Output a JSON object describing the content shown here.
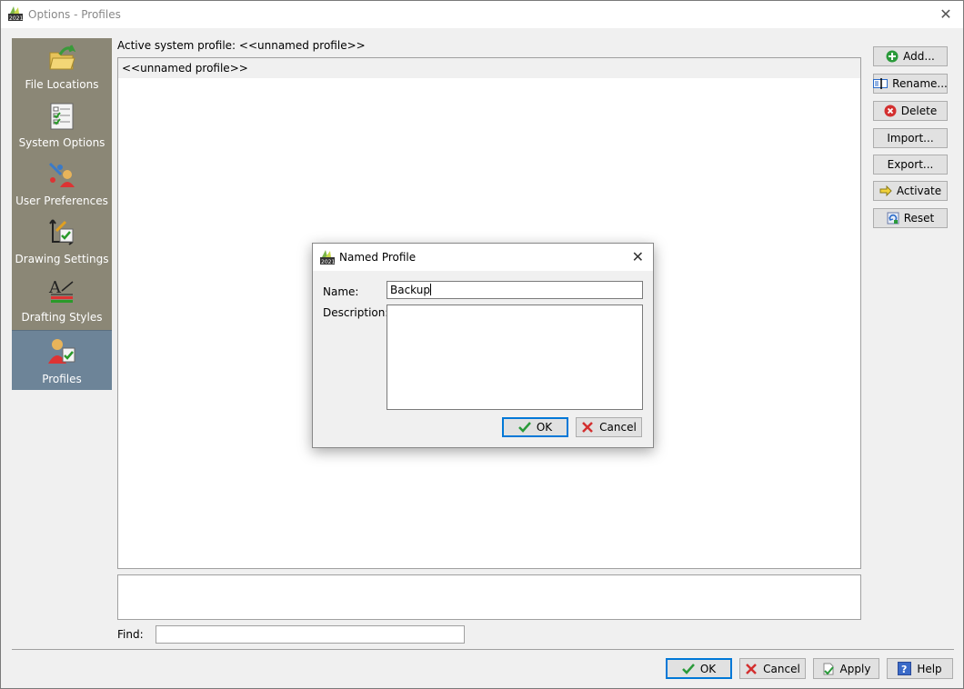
{
  "window": {
    "title": "Options - Profiles",
    "close_glyph": "✕"
  },
  "sidebar": {
    "items": [
      {
        "label": "File Locations",
        "icon": "folder-arrow-icon"
      },
      {
        "label": "System Options",
        "icon": "checklist-icon"
      },
      {
        "label": "User Preferences",
        "icon": "user-preferences-icon"
      },
      {
        "label": "Drawing Settings",
        "icon": "drawing-settings-icon"
      },
      {
        "label": "Drafting Styles",
        "icon": "drafting-styles-icon"
      },
      {
        "label": "Profiles",
        "icon": "profiles-icon",
        "active": true
      }
    ]
  },
  "main": {
    "active_profile_label": "Active system profile:  <<unnamed profile>>",
    "profiles": [
      "<<unnamed profile>>"
    ],
    "find_label": "Find:"
  },
  "right_buttons": {
    "add": "Add...",
    "rename": "Rename...",
    "delete": "Delete",
    "import": "Import...",
    "export": "Export...",
    "activate": "Activate",
    "reset": "Reset"
  },
  "bottom_buttons": {
    "ok": "OK",
    "cancel": "Cancel",
    "apply": "Apply",
    "help": "Help"
  },
  "dialog": {
    "title": "Named Profile",
    "name_label": "Name:",
    "name_value": "Backup",
    "description_label": "Description:",
    "ok": "OK",
    "cancel": "Cancel",
    "close_glyph": "✕"
  },
  "colors": {
    "sidebar_bg": "#8b8776",
    "sidebar_active": "#6d8498",
    "primary_border": "#0078d7"
  }
}
